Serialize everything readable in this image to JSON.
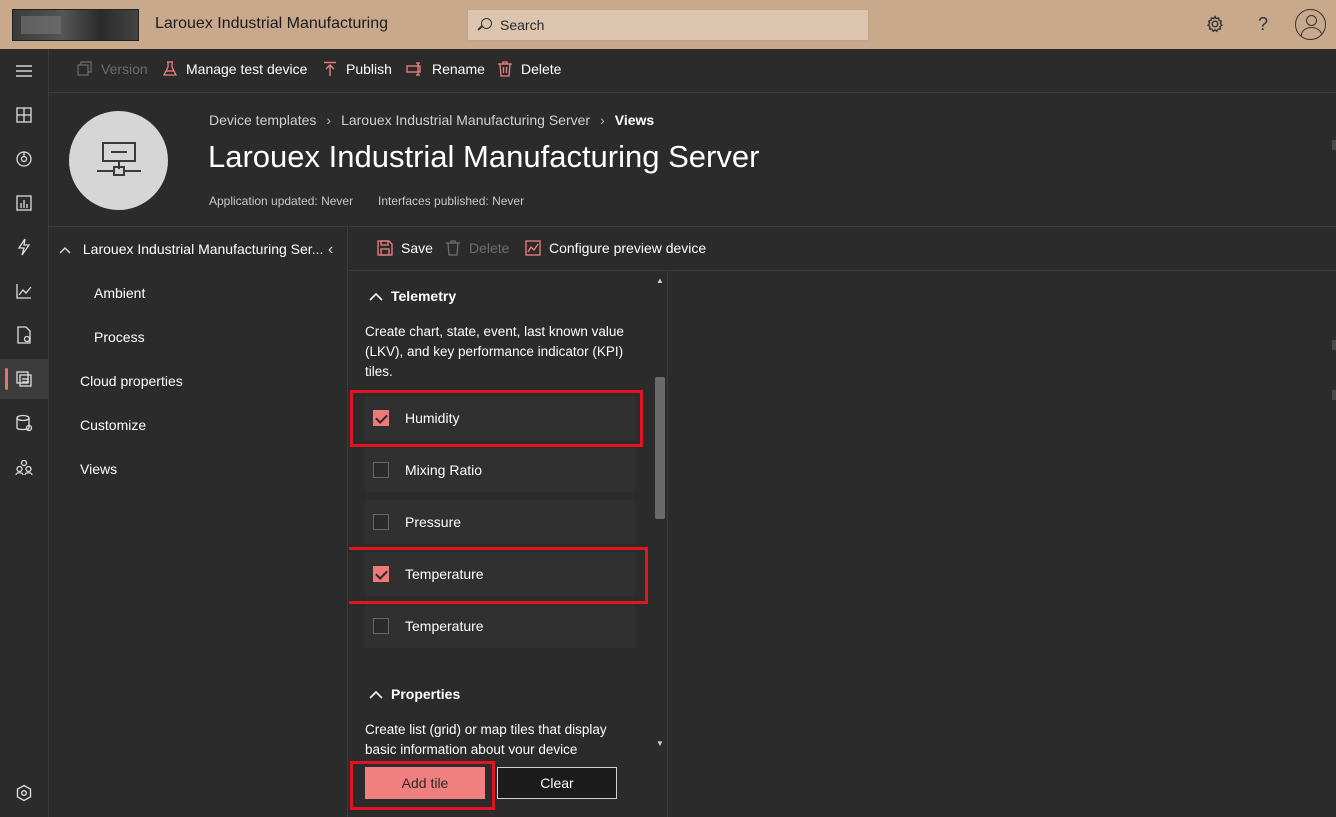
{
  "topbar": {
    "app_title": "Larouex Industrial Manufacturing",
    "search_placeholder": "Search",
    "settings_icon": "gear-icon",
    "help_label": "?"
  },
  "commands": {
    "version": "Version",
    "manage_test_device": "Manage test device",
    "publish": "Publish",
    "rename": "Rename",
    "delete": "Delete"
  },
  "breadcrumb": {
    "items": [
      "Device templates",
      "Larouex Industrial Manufacturing Server",
      "Views"
    ]
  },
  "page": {
    "title": "Larouex Industrial Manufacturing Server",
    "application_updated": "Application updated: Never",
    "interfaces_published": "Interfaces published: Never"
  },
  "tree": {
    "root_label": "Larouex Industrial Manufacturing Ser...",
    "children": [
      "Ambient",
      "Process"
    ],
    "items": [
      "Cloud properties",
      "Customize",
      "Views"
    ]
  },
  "editor_commands": {
    "save": "Save",
    "delete": "Delete",
    "configure_preview": "Configure preview device"
  },
  "library": {
    "telemetry": {
      "heading": "Telemetry",
      "description": "Create chart, state, event, last known value (LKV), and key performance indicator (KPI) tiles.",
      "items": [
        {
          "label": "Humidity",
          "checked": true
        },
        {
          "label": "Mixing Ratio",
          "checked": false
        },
        {
          "label": "Pressure",
          "checked": false
        },
        {
          "label": "Temperature",
          "checked": true
        },
        {
          "label": "Temperature",
          "checked": false
        }
      ]
    },
    "properties": {
      "heading": "Properties",
      "description": "Create list (grid) or map tiles that display basic information about your device"
    },
    "add_tile": "Add tile",
    "clear": "Clear"
  },
  "colors": {
    "header_bg": "#c9a98c",
    "accent": "#f08080",
    "highlight": "#e2141f",
    "background": "#2b2b2b"
  }
}
